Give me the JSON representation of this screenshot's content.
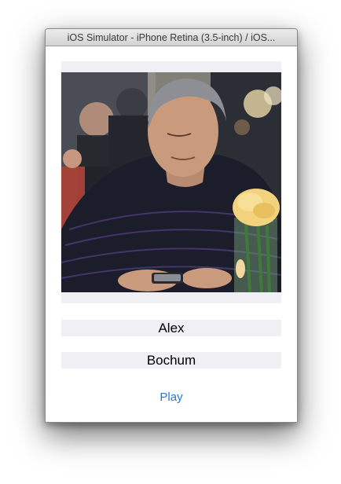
{
  "window": {
    "title": "iOS Simulator - iPhone Retina (3.5-inch) / iOS..."
  },
  "profile": {
    "photo_icon": "person-photo",
    "name": "Alex",
    "city": "Bochum"
  },
  "actions": {
    "play_label": "Play"
  },
  "colors": {
    "field_background": "#efeff4",
    "link": "#1a7bd6"
  }
}
